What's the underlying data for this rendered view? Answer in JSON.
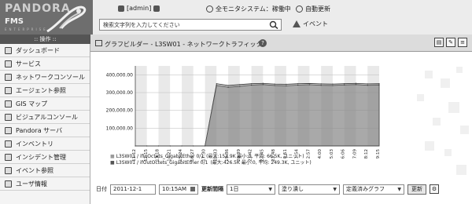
{
  "header": {
    "logo_top": "PANDORA",
    "logo_main": "FMS",
    "logo_sub": "ENTERPRISE",
    "user": "[admin]",
    "system_status": "全モニタシステム：稼働中",
    "auto_refresh": "自動更新",
    "events": "イベント",
    "search_placeholder": "検索文字列を入力してください"
  },
  "menu": {
    "title": "操作",
    "items": [
      {
        "label": "ダッシュボード",
        "icon": "dashboard-icon"
      },
      {
        "label": "サービス",
        "icon": "services-icon"
      },
      {
        "label": "ネットワークコンソール",
        "icon": "network-console-icon"
      },
      {
        "label": "エージェント参照",
        "icon": "agent-icon"
      },
      {
        "label": "GIS マップ",
        "icon": "gis-map-icon"
      },
      {
        "label": "ビジュアルコンソール",
        "icon": "visual-console-icon"
      },
      {
        "label": "Pandora サーバ",
        "icon": "server-icon"
      },
      {
        "label": "インベントリ",
        "icon": "inventory-icon"
      },
      {
        "label": "インシデント管理",
        "icon": "incident-icon"
      },
      {
        "label": "イベント参照",
        "icon": "event-icon"
      },
      {
        "label": "ユーザ情報",
        "icon": "user-icon"
      }
    ]
  },
  "main": {
    "title": "グラフビルダー - L3SW01 - ネットワークトラフィック",
    "help": "?"
  },
  "chart_data": {
    "type": "area",
    "y_ticks": [
      "400,000.00",
      "300,000.00",
      "200,000.00",
      "100,000.00"
    ],
    "y_tick_values": [
      400000,
      300000,
      200000,
      100000
    ],
    "ylim": [
      0,
      450000
    ],
    "x": [
      "11:12",
      "12:15",
      "13:18",
      "14:21",
      "15:24",
      "16:27",
      "17:30",
      "18:33",
      "19:36",
      "20:39",
      "21:42",
      "22:45",
      "23:48",
      "0:51",
      "1:54",
      "2:57",
      "4:00",
      "5:03",
      "6:06",
      "7:09",
      "8:12",
      "9:15"
    ],
    "x_labels": [
      "11:12",
      "12:15",
      "13:18",
      "14:21",
      "15:24",
      "16:27",
      "17:30",
      "18:33",
      "19:36",
      "20:39",
      "21:42",
      "22:45",
      "23:48",
      "0:51",
      "1:54",
      "2:57",
      "4:00",
      "5:03",
      "6:06",
      "7:09",
      "8:12",
      "9:15"
    ],
    "series": [
      {
        "name": "L3SW01 / ifInOctets_GigabitEther 0/1",
        "values": [
          0,
          0,
          0,
          0,
          0,
          0,
          0,
          350000,
          340000,
          345000,
          350000,
          352000,
          348000,
          347000,
          350000,
          351000,
          349000,
          348000,
          350000,
          352000,
          349000,
          350000
        ]
      },
      {
        "name": "L3SW01 / ifOutOctets_GigabitEther 0/1",
        "values": [
          0,
          0,
          0,
          0,
          0,
          0,
          0,
          340000,
          330000,
          335000,
          342000,
          345000,
          340000,
          338000,
          342000,
          344000,
          341000,
          340000,
          343000,
          345000,
          341000,
          342000
        ]
      }
    ],
    "legend": [
      {
        "name": "L3SW01 / ifInOctets_GigabitEther 0/1",
        "stats": "(最大:153.9K 最小:0, 平均: 66.5K, ユニット)"
      },
      {
        "name": "L3SW01 / ifOutOctets_GigabitEther 0/1",
        "stats": "(最大:426.5K 最小:0, 平均: 249.3K, ユニット)"
      }
    ]
  },
  "form": {
    "date_label": "日付",
    "date_value": "2011-12-1",
    "time_value": "10:15AM",
    "period_label": "更新間隔",
    "period_value": "1日",
    "fill_value": "塗り潰し",
    "graph_type": "定義済みグラフ",
    "refresh_button": "更新"
  }
}
